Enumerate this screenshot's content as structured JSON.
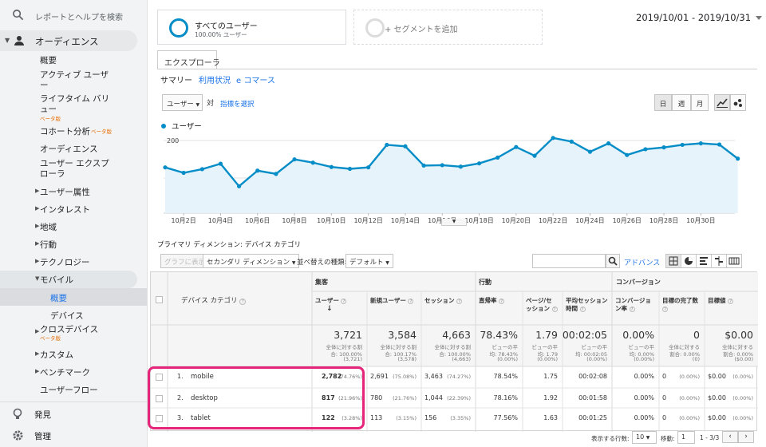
{
  "sidebar": {
    "search_label": "レポートとヘルプを検索",
    "audience_label": "オーディエンス",
    "items": [
      "概要",
      "アクティブ ユーザ",
      "ー",
      "ライフタイム バリ",
      "ュー",
      "コホート分析",
      "オーディエンス",
      "ユーザー エクスプ",
      "ローラ"
    ],
    "beta": "ベータ版",
    "subsections": [
      "ユーザー属性",
      "インタレスト",
      "地域",
      "行動",
      "テクノロジー",
      "モバイル"
    ],
    "mobile_children": [
      "概要",
      "デバイス"
    ],
    "more": [
      "クロスデバイス",
      "カスタム",
      "ベンチマーク",
      "ユーザーフロー"
    ],
    "bottom": [
      "発見",
      "管理"
    ]
  },
  "segments": {
    "all_users": "すべてのユーザー",
    "all_users_pct": "100.00% ユーザー",
    "add_segment": "+ セグメントを追加"
  },
  "date_range": "2019/10/01 - 2019/10/31",
  "tabs": {
    "explorer": "エクスプローラ",
    "sub": [
      "サマリー",
      "利用状況",
      "e コマース"
    ]
  },
  "controls": {
    "metric_select": "ユーザー",
    "vs": "対",
    "choose_metric": "指標を選択",
    "periods": [
      "日",
      "週",
      "月"
    ]
  },
  "chart_data": {
    "type": "line",
    "series": [
      {
        "name": "ユーザー",
        "values": [
          126,
          111,
          121,
          136,
          74,
          117,
          108,
          148,
          139,
          127,
          122,
          126,
          188,
          184,
          131,
          132,
          128,
          137,
          153,
          182,
          158,
          207,
          197,
          169,
          192,
          160,
          176,
          181,
          188,
          192,
          189,
          150
        ]
      }
    ],
    "x_tick_labels": [
      "10月2日",
      "10月4日",
      "10月6日",
      "10月8日",
      "10月10日",
      "10月12日",
      "10月14日",
      "10月16日",
      "10月18日",
      "10月20日",
      "10月22日",
      "10月24日",
      "10月26日",
      "10月28日",
      "10月30日"
    ],
    "y_tick_labels": [
      "200",
      "100"
    ],
    "ylim": [
      0,
      220
    ],
    "color": "#058dc7"
  },
  "dimension": {
    "label": "プライマリ ディメンション:",
    "value": "デバイス カテゴリ"
  },
  "grid_controls": {
    "chart_btn": "グラフに表示",
    "secondary": "セカンダリ ディメンション",
    "sort_label": "並べ替えの種類:",
    "sort_value": "デフォルト",
    "advanced": "アドバンス"
  },
  "table": {
    "dim_header": "デバイス カテゴリ",
    "groups": [
      "集客",
      "行動",
      "コンバージョン"
    ],
    "columns": [
      "ユーザー",
      "新規ユーザー",
      "セッション",
      "直帰率",
      "ページ/セ ッション",
      "平均セッション 時間",
      "コンバージョン率",
      "目標の完了数",
      "目標値"
    ],
    "totals": {
      "values": [
        "3,721",
        "3,584",
        "4,663",
        "78.43%",
        "1.79",
        "00:02:05",
        "0.00%",
        "0",
        "$0.00"
      ],
      "subs": [
        [
          "全体に対する割",
          "合: 100.00%",
          "(3,721)"
        ],
        [
          "全体に対する割",
          "合: 100.17%",
          "(3,578)"
        ],
        [
          "全体に対する割",
          "合: 100.00%",
          "(4,663)"
        ],
        [
          "ビューの平",
          "均: 78.43%",
          "(0.00%)"
        ],
        [
          "ビューの平",
          "均: 1.79",
          "(0.00%)"
        ],
        [
          "ビューの平",
          "均: 00:02:05",
          "(0.00%)"
        ],
        [
          "ビューの平",
          "均: 0.00%",
          "(0.00%)"
        ],
        [
          "全体に対する",
          "割合: 0.00%",
          "(0)"
        ],
        [
          "全体に対する",
          "割合: 0.00%",
          "($0.00)"
        ]
      ]
    },
    "rows": [
      {
        "num": "1.",
        "name": "mobile",
        "users": "2,782",
        "users_pct": "(74.76%)",
        "new": "2,691",
        "new_pct": "(75.08%)",
        "sess": "3,463",
        "sess_pct": "(74.27%)",
        "bounce": "78.54%",
        "pps": "1.75",
        "dur": "00:02:08",
        "conv": "0.00%",
        "goals": "0",
        "goals_pct": "(0.00%)",
        "gval": "$0.00",
        "gval_pct": "(0.00%)"
      },
      {
        "num": "2.",
        "name": "desktop",
        "users": "817",
        "users_pct": "(21.96%)",
        "new": "780",
        "new_pct": "(21.76%)",
        "sess": "1,044",
        "sess_pct": "(22.39%)",
        "bounce": "78.16%",
        "pps": "1.92",
        "dur": "00:01:58",
        "conv": "0.00%",
        "goals": "0",
        "goals_pct": "(0.00%)",
        "gval": "$0.00",
        "gval_pct": "(0.00%)"
      },
      {
        "num": "3.",
        "name": "tablet",
        "users": "122",
        "users_pct": "(3.28%)",
        "new": "113",
        "new_pct": "(3.15%)",
        "sess": "156",
        "sess_pct": "(3.35%)",
        "bounce": "77.56%",
        "pps": "1.63",
        "dur": "00:01:25",
        "conv": "0.00%",
        "goals": "0",
        "goals_pct": "(0.00%)",
        "gval": "$0.00",
        "gval_pct": "(0.00%)"
      }
    ]
  },
  "footer": {
    "rows_label": "表示する行数:",
    "rows_value": "10",
    "goto_label": "移動:",
    "goto_value": "1",
    "range": "1 - 3/3"
  }
}
